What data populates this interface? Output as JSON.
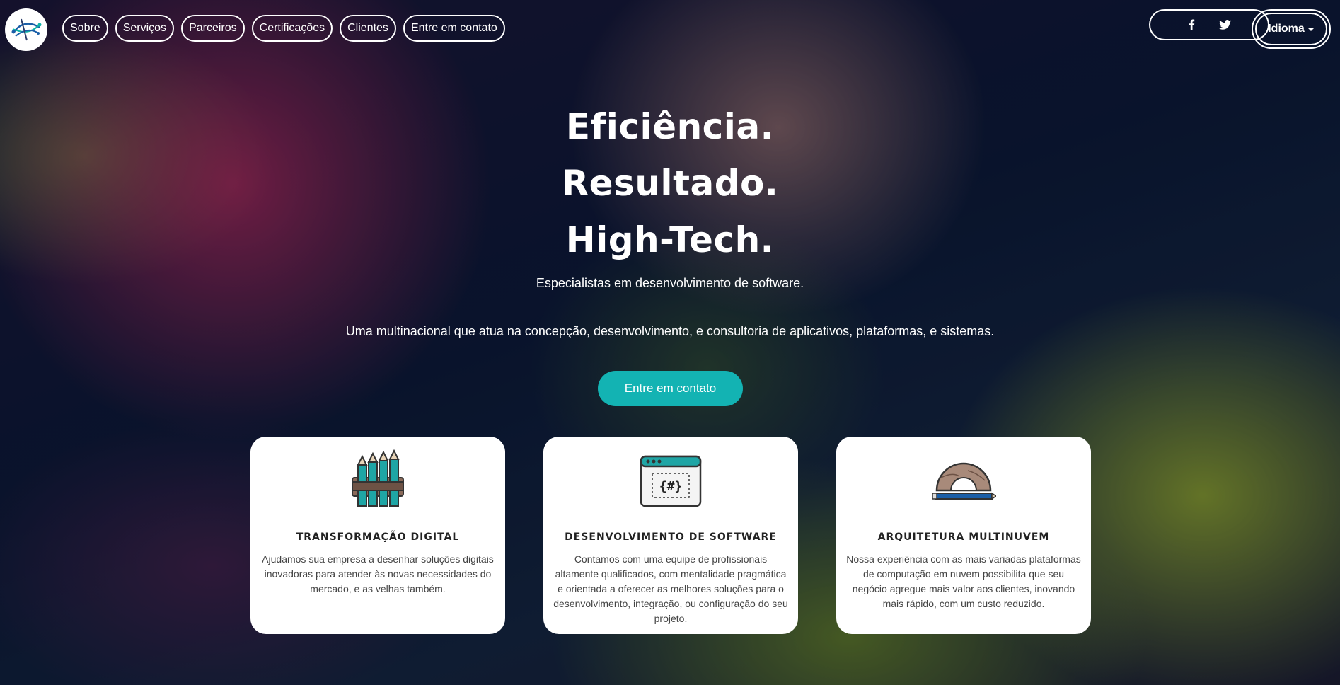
{
  "nav": {
    "items": [
      {
        "label": "Sobre"
      },
      {
        "label": "Serviços"
      },
      {
        "label": "Parceiros"
      },
      {
        "label": "Certificações"
      },
      {
        "label": "Clientes"
      },
      {
        "label": "Entre em contato"
      }
    ]
  },
  "social": {
    "facebook_icon": "f",
    "twitter_icon": "twitter-bird"
  },
  "language": {
    "label": "Idioma"
  },
  "hero": {
    "line1": "Eficiência.",
    "line2": "Resultado.",
    "line3": "High-Tech.",
    "subtitle": "Especialistas em desenvolvimento de software.",
    "description": "Uma multinacional que atua na concepção, desenvolvimento, e consultoria de aplicativos, plataformas, e sistemas.",
    "cta_label": "Entre em contato"
  },
  "cards": [
    {
      "icon": "pencils-icon",
      "title": "TRANSFORMAÇÃO DIGITAL",
      "text": "Ajudamos sua empresa a desenhar soluções digitais inovadoras para atender às novas necessidades do mercado, e as velhas também."
    },
    {
      "icon": "code-window-icon",
      "title": "DESENVOLVIMENTO DE SOFTWARE",
      "text": "Contamos com uma equipe de profissionais altamente qualificados, com mentalidade pragmática e orientada a oferecer as melhores soluções para o desenvolvimento, integração, ou configuração do seu projeto."
    },
    {
      "icon": "protractor-icon",
      "title": "ARQUITETURA MULTINUVEM",
      "text": "Nossa experiência com as mais variadas plataformas de computação em nuvem possibilita que seu negócio agregue mais valor aos clientes, inovando mais rápido, com um custo reduzido."
    }
  ],
  "colors": {
    "accent": "#13b3b3",
    "card_bg": "#ffffff",
    "text_dark": "#222222"
  }
}
